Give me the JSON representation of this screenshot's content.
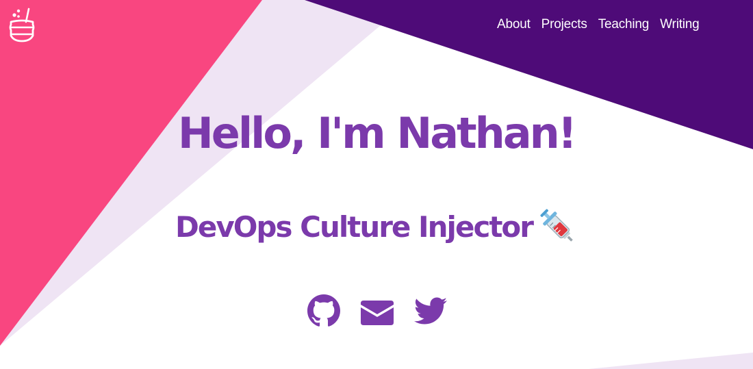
{
  "brand": {
    "logo_icon": "cauldron-icon"
  },
  "nav": {
    "items": [
      {
        "label": "About"
      },
      {
        "label": "Projects"
      },
      {
        "label": "Teaching"
      },
      {
        "label": "Writing"
      }
    ]
  },
  "hero": {
    "title": "Hello, I'm Nathan!",
    "subtitle": "DevOps Culture Injector",
    "subtitle_emoji": "syringe-icon"
  },
  "socials": [
    {
      "icon": "github-icon"
    },
    {
      "icon": "email-icon"
    },
    {
      "icon": "twitter-icon"
    }
  ],
  "colors": {
    "accent": "#7b3aab",
    "pink": "#f94680",
    "lavender": "#efe4f4",
    "deep_purple": "#4e0b78",
    "white": "#ffffff"
  }
}
